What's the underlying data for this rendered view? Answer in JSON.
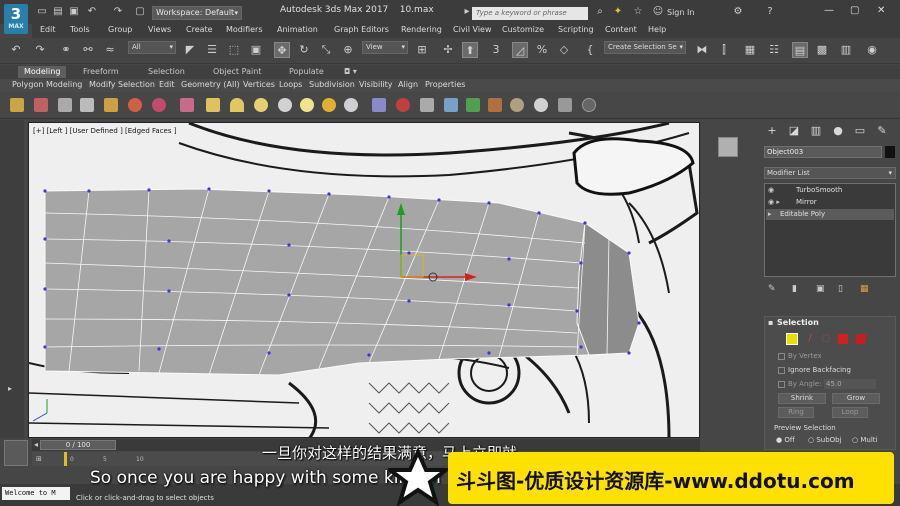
{
  "app": {
    "title": "Autodesk 3ds Max 2017",
    "file": "10.max",
    "logo_main": "3",
    "logo_sub": "MAX",
    "workspace": "Workspace: Default",
    "search_placeholder": "Type a keyword or phrase",
    "signin": "Sign In"
  },
  "menus": [
    "Edit",
    "Tools",
    "Group",
    "Views",
    "Create",
    "Modifiers",
    "Animation",
    "Graph Editors",
    "Rendering",
    "Civil View",
    "Customize",
    "Scripting",
    "Content",
    "Help"
  ],
  "toolbar": {
    "selection_filter": "All",
    "ref_coord": "View",
    "named_selection": "Create Selection Se"
  },
  "ribbon": {
    "tabs": [
      "Modeling",
      "Freeform",
      "Selection",
      "Object Paint",
      "Populate"
    ],
    "active_tab": "Modeling",
    "panels": [
      "Polygon Modeling",
      "Modify Selection",
      "Edit",
      "Geometry (All)",
      "Vertices",
      "Loops",
      "Subdivision",
      "Visibility",
      "Align",
      "Properties"
    ]
  },
  "viewport": {
    "label": "[+] [Left ] [User Defined ] [Edged Faces ]"
  },
  "command_panel": {
    "object_name": "Object003",
    "modifier_list": "Modifier List",
    "stack": [
      "TurboSmooth",
      "Mirror",
      "Editable Poly"
    ],
    "selection_title": "Selection",
    "by_vertex": "By Vertex",
    "ignore_backfacing": "Ignore Backfacing",
    "by_angle": "By Angle:",
    "angle_value": "45.0",
    "shrink": "Shrink",
    "grow": "Grow",
    "ring": "Ring",
    "loop": "Loop",
    "preview_selection": "Preview Selection",
    "preview_off": "Off",
    "preview_subobj": "SubObj",
    "preview_multi": "Multi"
  },
  "timeline": {
    "frame": "0 / 100",
    "ticks": [
      "0",
      "5",
      "10"
    ]
  },
  "status": {
    "welcome": "Welcome to M",
    "prompt": "Click or click-and-drag to select objects"
  },
  "subtitles": {
    "chinese": "一旦你对这样的结果满意，马上立即就",
    "english": "So once you are happy with some kind of"
  },
  "watermark": {
    "text": "斗斗图-优质设计资源库-www.ddotu.com"
  },
  "colors": {
    "accent_blue": "#2a7fa8",
    "watermark_yellow": "#ffe100",
    "gizmo_red": "#d62020",
    "gizmo_green": "#1aa01a",
    "vertex_blue": "#3a3ad0"
  }
}
